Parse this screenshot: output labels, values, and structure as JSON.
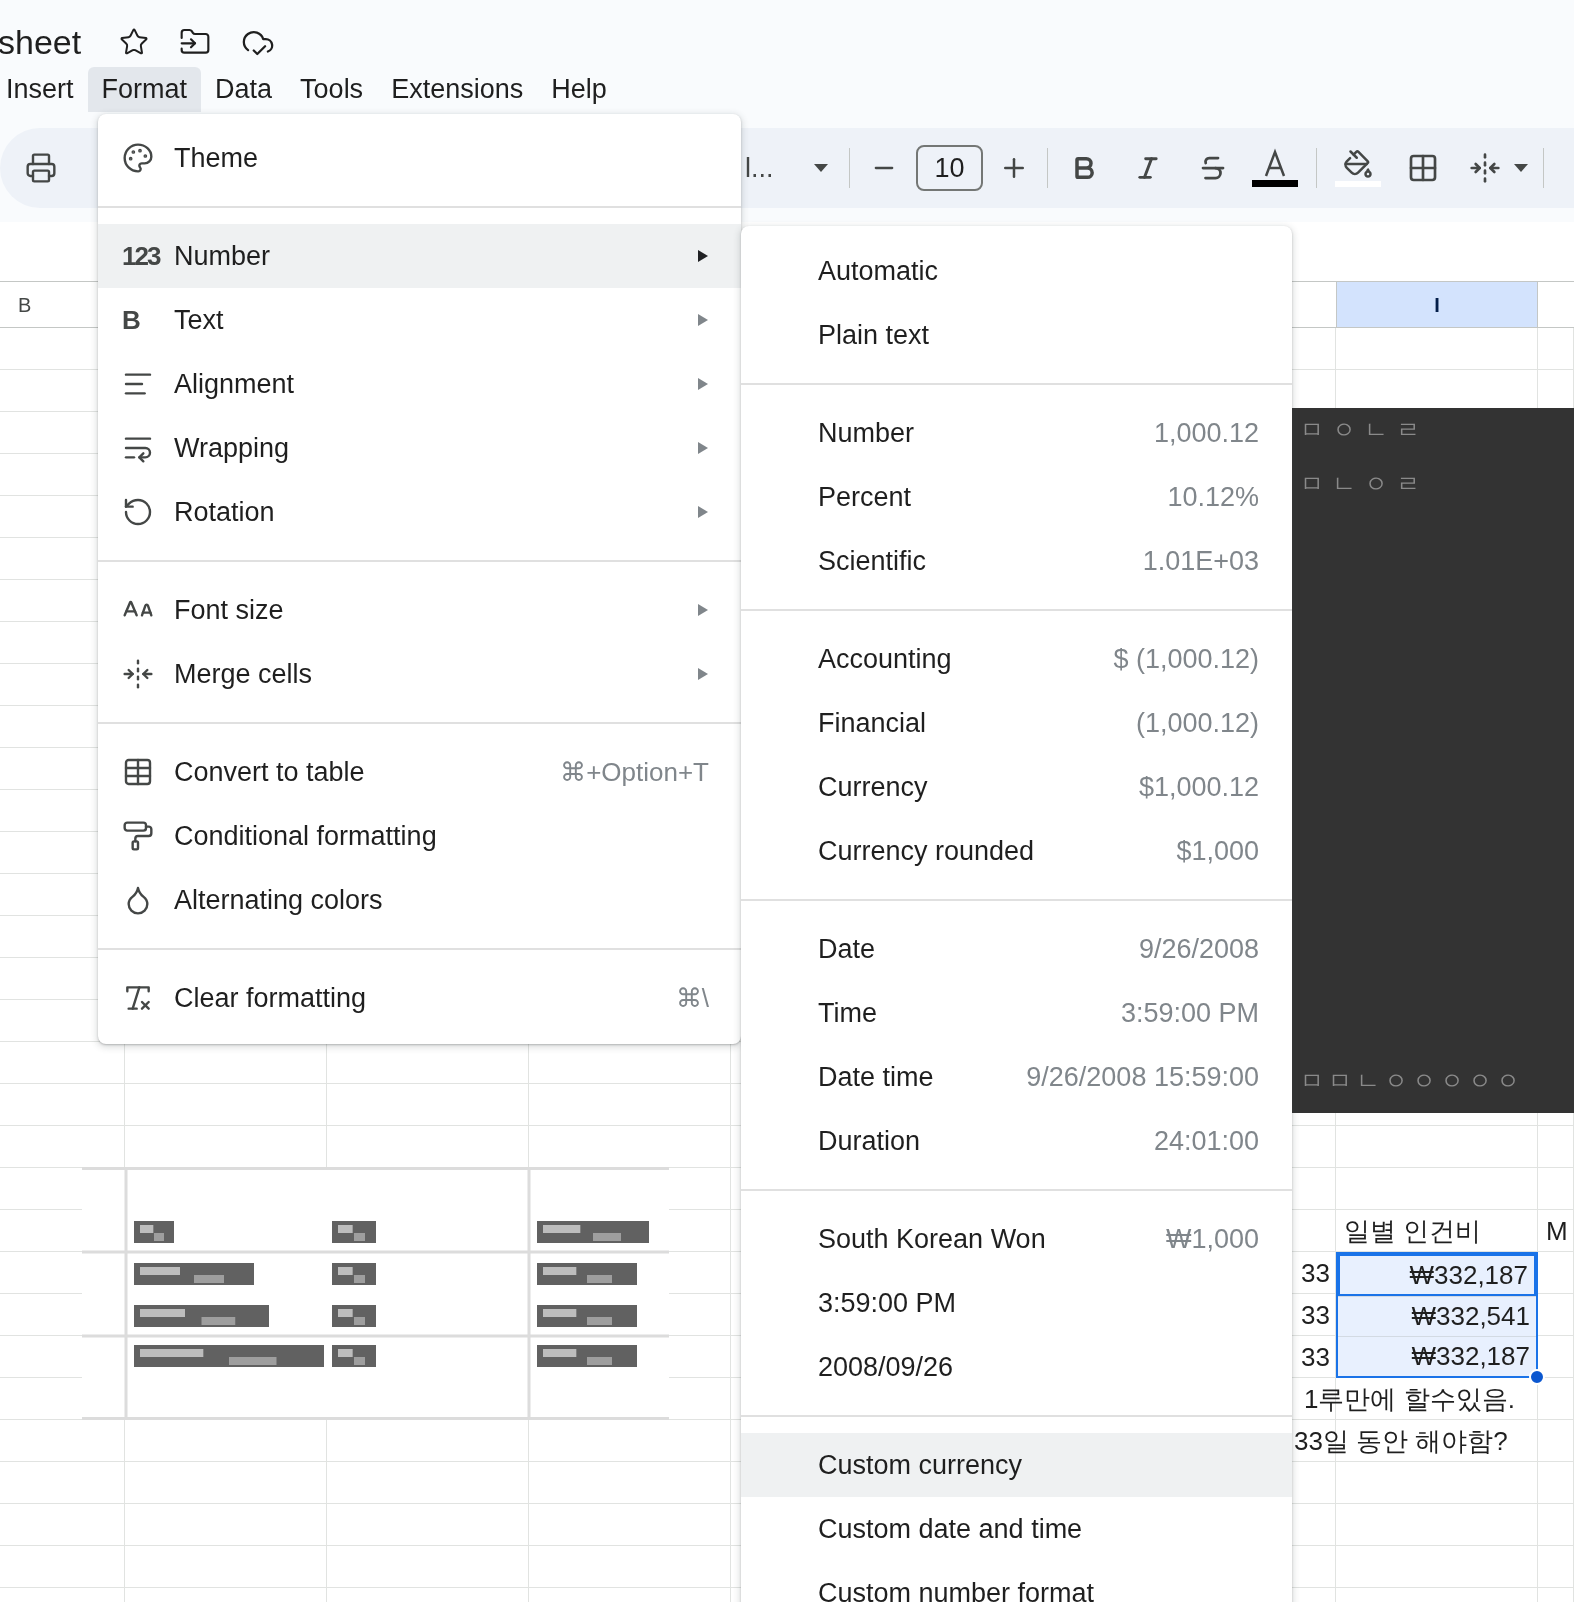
{
  "document": {
    "title": "sheet"
  },
  "menubar": [
    {
      "label": "Insert",
      "selected": false
    },
    {
      "label": "Format",
      "selected": true
    },
    {
      "label": "Data",
      "selected": false
    },
    {
      "label": "Tools",
      "selected": false
    },
    {
      "label": "Extensions",
      "selected": false
    },
    {
      "label": "Help",
      "selected": false
    }
  ],
  "toolbar": {
    "font_name": "l...",
    "font_size": "10"
  },
  "column_headers": [
    {
      "label": "B",
      "selected": false
    },
    {
      "label": "I",
      "selected": true
    }
  ],
  "format_menu": [
    {
      "kind": "item",
      "label": "Theme",
      "submenu": false,
      "highlighted": false
    },
    {
      "kind": "separator"
    },
    {
      "kind": "item",
      "label": "Number",
      "icon_text": "123",
      "submenu": true,
      "highlighted": true
    },
    {
      "kind": "item",
      "label": "Text",
      "icon_text": "B",
      "submenu": true,
      "highlighted": false
    },
    {
      "kind": "item",
      "label": "Alignment",
      "submenu": true,
      "highlighted": false
    },
    {
      "kind": "item",
      "label": "Wrapping",
      "submenu": true,
      "highlighted": false
    },
    {
      "kind": "item",
      "label": "Rotation",
      "submenu": true,
      "highlighted": false
    },
    {
      "kind": "separator"
    },
    {
      "kind": "item",
      "label": "Font size",
      "submenu": true,
      "highlighted": false
    },
    {
      "kind": "item",
      "label": "Merge cells",
      "submenu": true,
      "highlighted": false
    },
    {
      "kind": "separator"
    },
    {
      "kind": "item",
      "label": "Convert to table",
      "shortcut": "⌘+Option+T",
      "submenu": false,
      "highlighted": false
    },
    {
      "kind": "item",
      "label": "Conditional formatting",
      "submenu": false,
      "highlighted": false
    },
    {
      "kind": "item",
      "label": "Alternating colors",
      "submenu": false,
      "highlighted": false
    },
    {
      "kind": "separator"
    },
    {
      "kind": "item",
      "label": "Clear formatting",
      "shortcut": "⌘\\",
      "submenu": false,
      "highlighted": false
    }
  ],
  "number_submenu": [
    {
      "kind": "item",
      "label": "Automatic",
      "highlighted": false
    },
    {
      "kind": "item",
      "label": "Plain text",
      "highlighted": false
    },
    {
      "kind": "separator"
    },
    {
      "kind": "item",
      "label": "Number",
      "value": "1,000.12",
      "highlighted": false
    },
    {
      "kind": "item",
      "label": "Percent",
      "value": "10.12%",
      "highlighted": false
    },
    {
      "kind": "item",
      "label": "Scientific",
      "value": "1.01E+03",
      "highlighted": false
    },
    {
      "kind": "separator"
    },
    {
      "kind": "item",
      "label": "Accounting",
      "value": "$ (1,000.12)",
      "highlighted": false
    },
    {
      "kind": "item",
      "label": "Financial",
      "value": "(1,000.12)",
      "highlighted": false
    },
    {
      "kind": "item",
      "label": "Currency",
      "value": "$1,000.12",
      "highlighted": false
    },
    {
      "kind": "item",
      "label": "Currency rounded",
      "value": "$1,000",
      "highlighted": false
    },
    {
      "kind": "separator"
    },
    {
      "kind": "item",
      "label": "Date",
      "value": "9/26/2008",
      "highlighted": false
    },
    {
      "kind": "item",
      "label": "Time",
      "value": "3:59:00 PM",
      "highlighted": false
    },
    {
      "kind": "item",
      "label": "Date time",
      "value": "9/26/2008 15:59:00",
      "highlighted": false
    },
    {
      "kind": "item",
      "label": "Duration",
      "value": "24:01:00",
      "highlighted": false
    },
    {
      "kind": "separator"
    },
    {
      "kind": "item",
      "label": "South Korean Won",
      "value": "₩1,000",
      "highlighted": false
    },
    {
      "kind": "item",
      "label": "3:59:00 PM",
      "highlighted": false
    },
    {
      "kind": "item",
      "label": "2008/09/26",
      "highlighted": false
    },
    {
      "kind": "separator"
    },
    {
      "kind": "item",
      "label": "Custom currency",
      "highlighted": true
    },
    {
      "kind": "item",
      "label": "Custom date and time",
      "highlighted": false
    },
    {
      "kind": "item",
      "label": "Custom number format",
      "highlighted": false
    }
  ],
  "dark_panel": {
    "lines": [
      "ㅁㅇㄴㄹ",
      "ㅁㄴㅇㄹ",
      "ㅁㅁㄴㅇㅇㅇㅇㅇ"
    ]
  },
  "cells": {
    "header": "일별 인건비",
    "next_header": "M",
    "rows": [
      {
        "count": "33",
        "amount": "₩332,187",
        "selected": true
      },
      {
        "count": "33",
        "amount": "₩332,541",
        "selected": true
      },
      {
        "count": "33",
        "amount": "₩332,187",
        "selected": true
      }
    ],
    "notes": [
      "1루만에 할수있음.",
      "33일 동안 해야함?"
    ]
  }
}
